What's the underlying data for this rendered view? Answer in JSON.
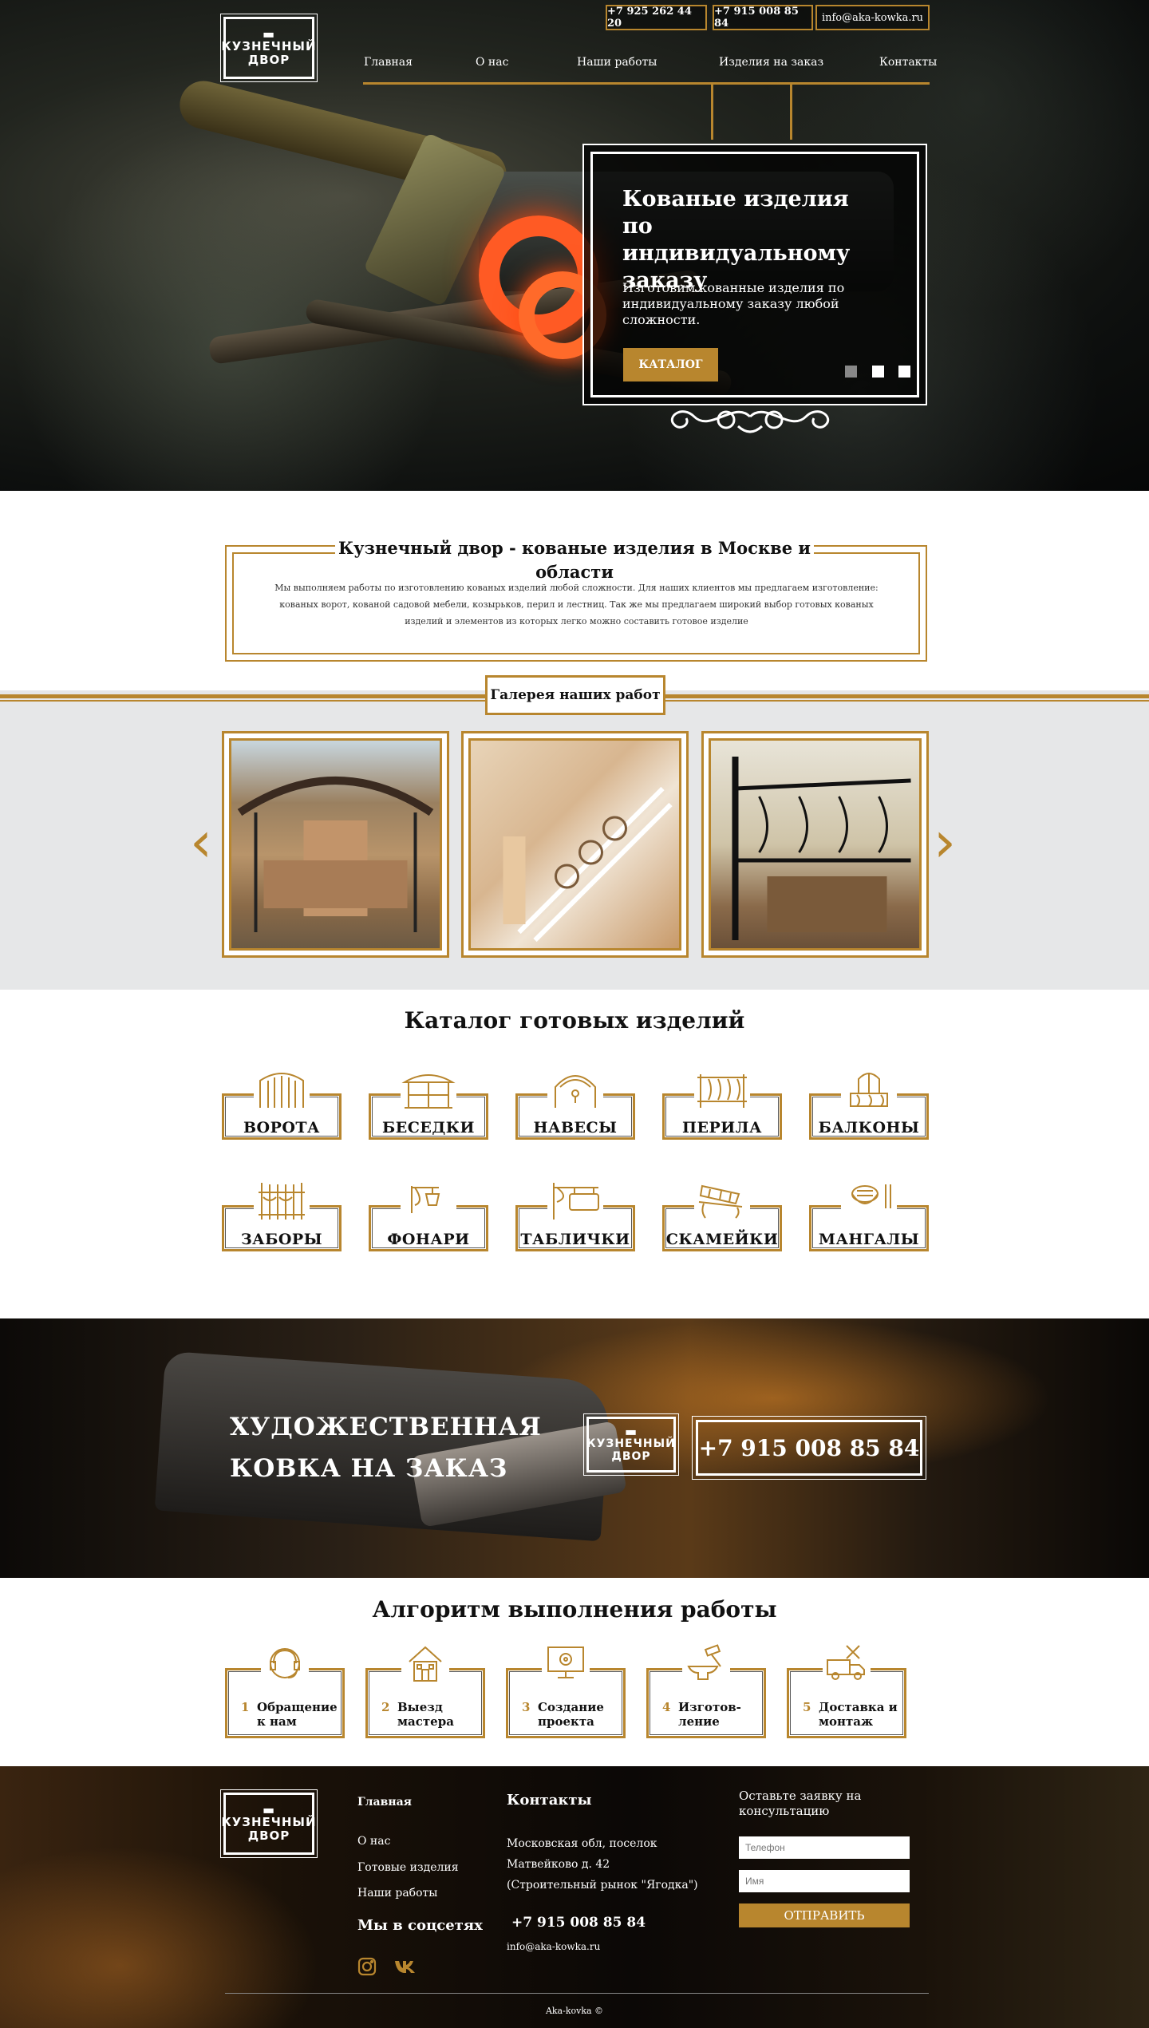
{
  "header": {
    "logo_line1": "КУЗНЕЧНЫЙ",
    "logo_line2": "ДВОР",
    "phone1": "+7 925 262 44 20",
    "phone2": "+7 915 008 85 84",
    "email": "info@aka-kowka.ru",
    "nav": [
      "Главная",
      "О нас",
      "Наши работы",
      "Изделия на заказ",
      "Контакты"
    ]
  },
  "hero": {
    "title": "Кованые изделия по индивидуальному заказу",
    "text": "Изготовим кованные изделия по индивидуальному заказу любой сложности.",
    "button": "КАТАЛОГ"
  },
  "intro": {
    "title": "Кузнечный двор - кованые изделия в Москве и области",
    "text": "Мы выполняем работы по изготовлению кованых изделий любой сложности. Для наших клиентов мы предлагаем изготовление: кованых ворот, кованой садовой мебели, козырьков, перил и лестниц. Так же мы предлагаем широкий выбор готовых кованых изделий и элементов из которых легко можно составить готовое изделие"
  },
  "gallery": {
    "title": "Галерея наших работ",
    "prev": "‹",
    "next": "›"
  },
  "catalog": {
    "title": "Каталог готовых изделий",
    "items": [
      "ВОРОТА",
      "БЕСЕДКИ",
      "НАВЕСЫ",
      "ПЕРИЛА",
      "БАЛКОНЫ",
      "ЗАБОРЫ",
      "ФОНАРИ",
      "ТАБЛИЧКИ",
      "СКАМЕЙКИ",
      "МАНГАЛЫ"
    ]
  },
  "cta": {
    "line1": "ХУДОЖЕСТВЕННАЯ",
    "line2": "КОВКА НА ЗАКАЗ",
    "phone": "+7 915 008 85 84"
  },
  "algorithm": {
    "title": "Алгоритм выполнения работы",
    "steps": [
      {
        "num": "1",
        "label": "Обращение к нам"
      },
      {
        "num": "2",
        "label": "Выезд мастера"
      },
      {
        "num": "3",
        "label": "Создание проекта"
      },
      {
        "num": "4",
        "label": "Изготов-ление"
      },
      {
        "num": "5",
        "label": "Доставка и монтаж"
      }
    ]
  },
  "footer": {
    "menu": [
      "Главная",
      "О нас",
      "Готовые изделия",
      "Наши работы"
    ],
    "social_title": "Мы в соцсетях",
    "contacts_title": "Контакты",
    "address": "Московская обл, поселок Матвейково д. 42 (Строительный рынок \"Ягодка\")",
    "phone": "+7 915 008 85 84",
    "email": "info@aka-kowka.ru",
    "form_title": "Оставьте заявку на консультацию",
    "phone_placeholder": "Телефон",
    "name_placeholder": "Имя",
    "submit": "ОТПРАВИТЬ",
    "copyright": "Aka-kovka ©"
  },
  "colors": {
    "accent": "#b8862e",
    "background_gray": "#e6e7e8",
    "text": "#111111"
  }
}
